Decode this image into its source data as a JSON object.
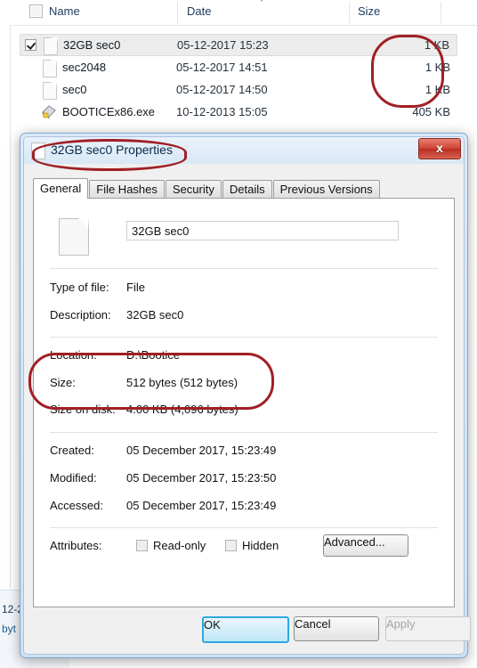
{
  "explorer": {
    "columns": [
      {
        "label": "Name"
      },
      {
        "label": "Date"
      },
      {
        "label": "Size"
      }
    ],
    "select_all_icon": "checkbox-unchecked-icon",
    "sort_indicator_icon": "sort-ascending-arrow-icon",
    "rows": [
      {
        "name": "32GB sec0",
        "date": "05-12-2017 15:23",
        "size": "1 KB",
        "icon": "file-document-icon",
        "checked": true,
        "selected": true
      },
      {
        "name": "sec2048",
        "date": "05-12-2017 14:51",
        "size": "1 KB",
        "icon": "file-document-icon",
        "checked": false,
        "selected": false
      },
      {
        "name": "sec0",
        "date": "05-12-2017 14:50",
        "size": "1 KB",
        "icon": "file-document-icon",
        "checked": false,
        "selected": false
      },
      {
        "name": "BOOTICEx86.exe",
        "date": "10-12-2013 15:05",
        "size": "405 KB",
        "icon": "executable-app-icon",
        "checked": false,
        "selected": false
      }
    ],
    "status": {
      "line1": "12-2",
      "line2": "byt"
    }
  },
  "dialog": {
    "title": "32GB sec0 Properties",
    "title_icon": "file-document-icon",
    "close_label": "x",
    "close_icon": "close-icon",
    "tabs": [
      {
        "label": "General",
        "active": true
      },
      {
        "label": "File Hashes",
        "active": false
      },
      {
        "label": "Security",
        "active": false
      },
      {
        "label": "Details",
        "active": false
      },
      {
        "label": "Previous Versions",
        "active": false
      }
    ],
    "general": {
      "file_icon": "file-document-icon",
      "filename_value": "32GB sec0",
      "fields": [
        {
          "label": "Type of file:",
          "value": "File"
        },
        {
          "label": "Description:",
          "value": "32GB sec0"
        },
        {
          "label": "Location:",
          "value": "D:\\Bootice"
        },
        {
          "label": "Size:",
          "value": "512 bytes (512 bytes)"
        },
        {
          "label": "Size on disk:",
          "value": "4.00 KB (4,096 bytes)"
        },
        {
          "label": "Created:",
          "value": "05 December 2017, 15:23:49"
        },
        {
          "label": "Modified:",
          "value": "05 December 2017, 15:23:50"
        },
        {
          "label": "Accessed:",
          "value": "05 December 2017, 15:23:49"
        }
      ],
      "attributes_label": "Attributes:",
      "readonly_label": "Read-only",
      "readonly_checked": false,
      "hidden_label": "Hidden",
      "hidden_checked": false,
      "advanced_label": "Advanced..."
    },
    "buttons": {
      "ok": "OK",
      "cancel": "Cancel",
      "apply": "Apply",
      "apply_disabled": true
    }
  },
  "annotations": {
    "color": "#a01f24",
    "items": [
      {
        "name": "annotation-sizes-column",
        "shape": "rounded-rect",
        "target": "file list Size column values"
      },
      {
        "name": "annotation-dialog-title",
        "shape": "ellipse",
        "target": "32GB sec0 Properties title"
      },
      {
        "name": "annotation-size-on-disk",
        "shape": "rounded-rect",
        "target": "Size and Size on disk rows"
      }
    ]
  }
}
